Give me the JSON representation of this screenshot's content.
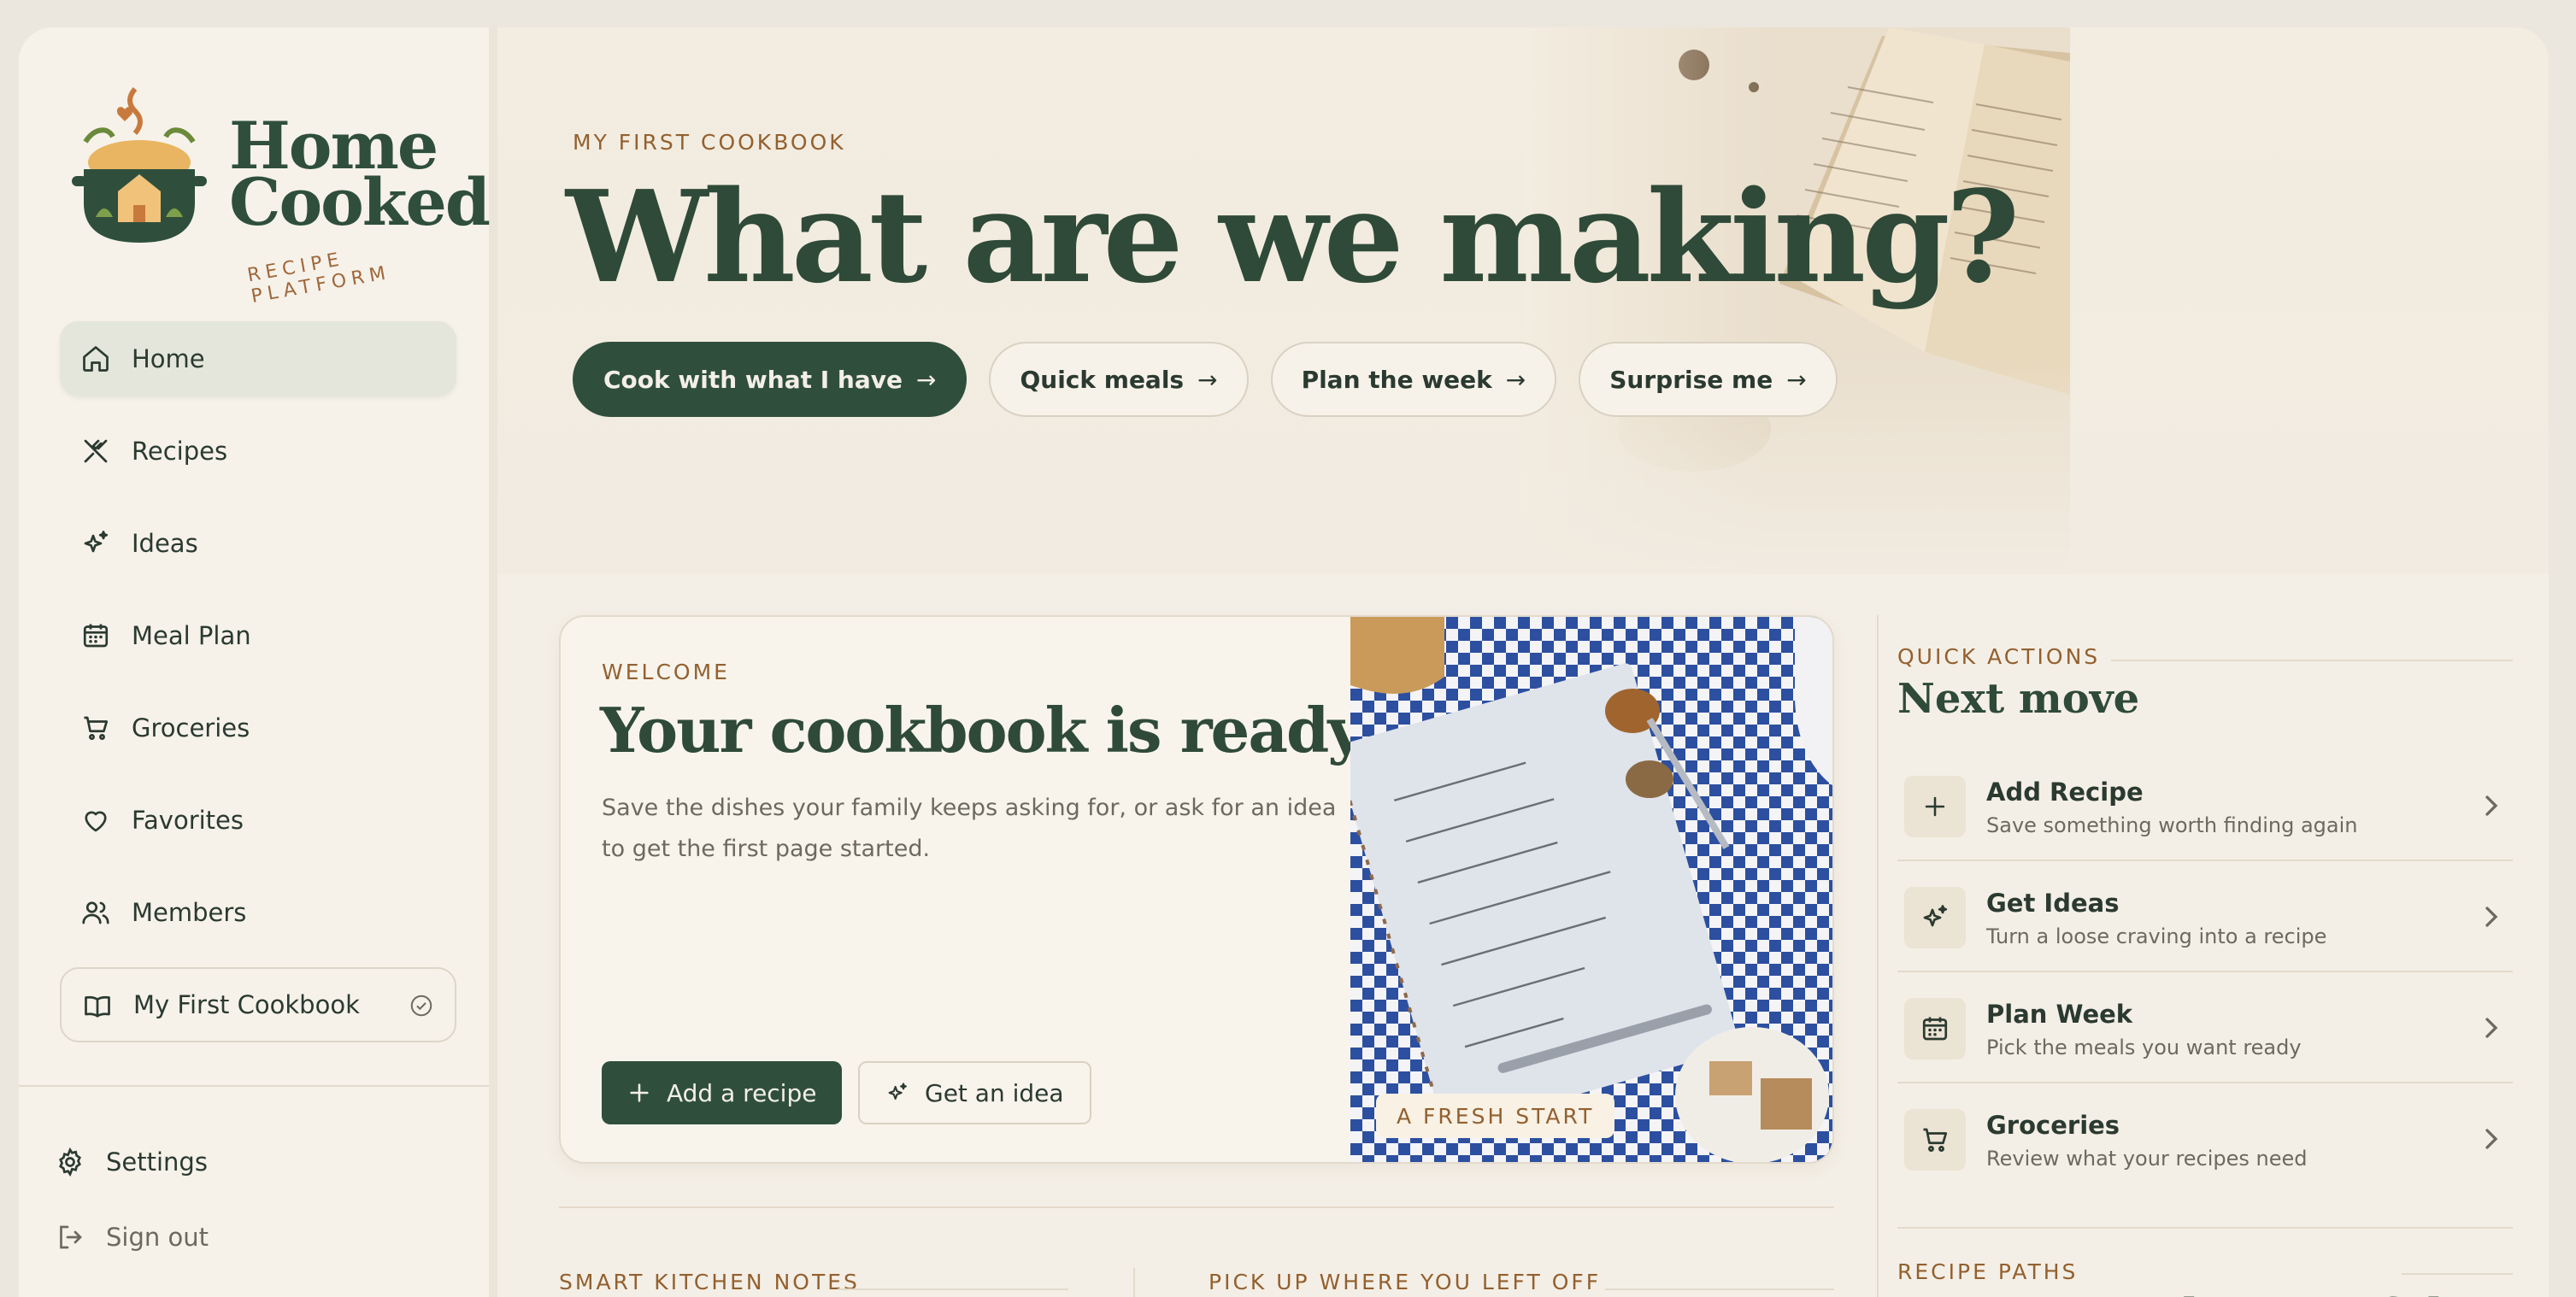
{
  "brand": {
    "name_line1": "Home",
    "name_line2": "Cooked",
    "tagline": "RECIPE PLATFORM"
  },
  "sidebar": {
    "items": [
      {
        "label": "Home",
        "icon": "home-icon",
        "active": true
      },
      {
        "label": "Recipes",
        "icon": "utensils-icon"
      },
      {
        "label": "Ideas",
        "icon": "sparkles-icon"
      },
      {
        "label": "Meal Plan",
        "icon": "calendar-icon"
      },
      {
        "label": "Groceries",
        "icon": "cart-icon"
      },
      {
        "label": "Favorites",
        "icon": "heart-icon"
      },
      {
        "label": "Members",
        "icon": "users-icon"
      }
    ],
    "cookbook": {
      "label": "My First Cookbook",
      "icon": "book-icon",
      "status_icon": "check-circle-icon"
    },
    "settings_label": "Settings",
    "signout_label": "Sign out"
  },
  "hero": {
    "eyebrow": "MY FIRST COOKBOOK",
    "title": "What are we making?",
    "chips": [
      {
        "label": "Cook with what I have",
        "primary": true
      },
      {
        "label": "Quick meals"
      },
      {
        "label": "Plan the week"
      },
      {
        "label": "Surprise me"
      }
    ],
    "arrow": "→"
  },
  "welcome": {
    "eyebrow": "WELCOME",
    "title": "Your cookbook is ready",
    "text": "Save the dishes your family keeps asking for, or ask for an idea to get the first page started.",
    "primary_button": "Add a recipe",
    "secondary_button": "Get an idea",
    "photo_badge": "A FRESH START"
  },
  "quick_actions": {
    "eyebrow": "QUICK ACTIONS",
    "title": "Next move",
    "items": [
      {
        "title": "Add Recipe",
        "desc": "Save something worth finding again",
        "icon": "plus-icon"
      },
      {
        "title": "Get Ideas",
        "desc": "Turn a loose craving into a recipe",
        "icon": "sparkles-icon"
      },
      {
        "title": "Plan Week",
        "desc": "Pick the meals you want ready",
        "icon": "calendar-icon"
      },
      {
        "title": "Groceries",
        "desc": "Review what your recipes need",
        "icon": "cart-icon"
      }
    ]
  },
  "recipe_paths": {
    "eyebrow": "RECIPE PATHS",
    "title": "Start somewhere useful"
  },
  "lower": {
    "smart_notes": "SMART KITCHEN NOTES",
    "pick_up": "PICK UP WHERE YOU LEFT OFF"
  },
  "colors": {
    "accent": "#2f4f3c",
    "eyebrow": "#93602f",
    "background": "#f4efe6"
  }
}
